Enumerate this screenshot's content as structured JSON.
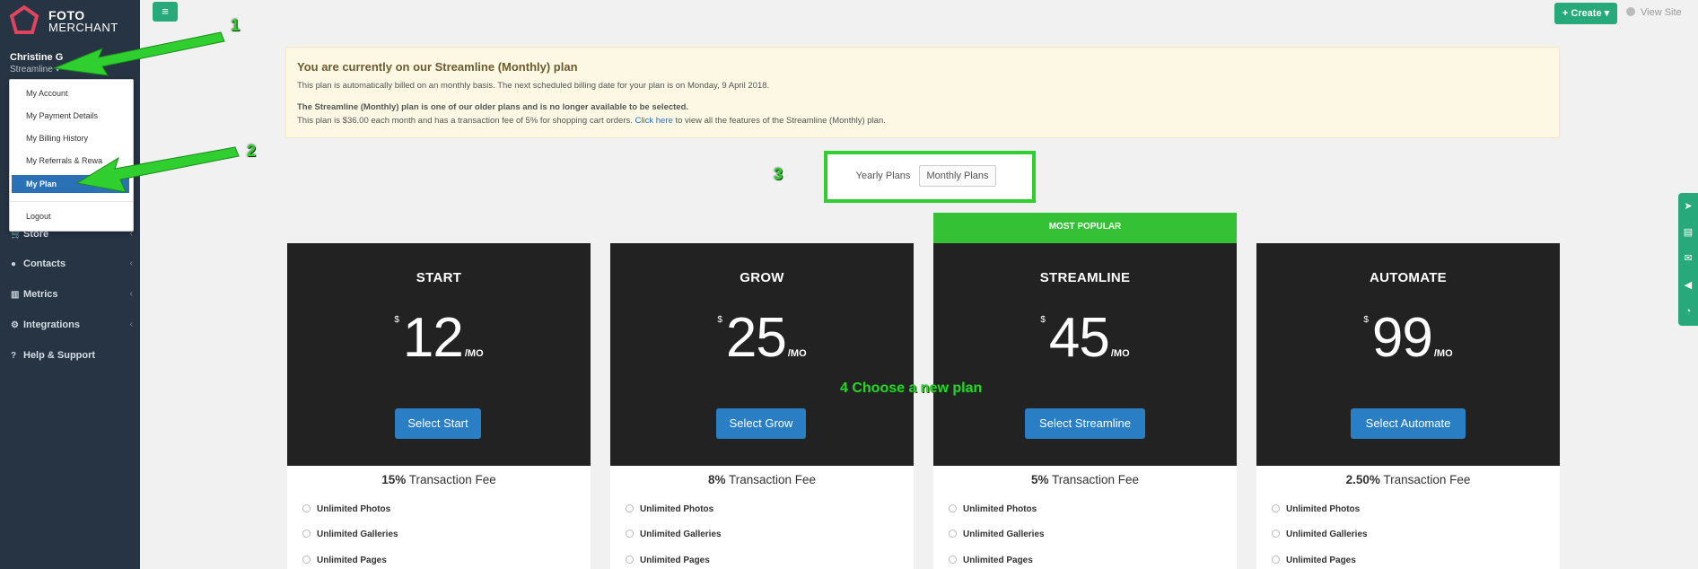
{
  "app": {
    "logo_line1": "FOTO",
    "logo_line2": "MERCHANT",
    "logo_tm": "™"
  },
  "sidebar": {
    "user_name": "Christine G",
    "user_plan": "Streamline ▾",
    "dropdown": [
      {
        "label": "My Account"
      },
      {
        "label": "My Payment Details"
      },
      {
        "label": "My Billing History"
      },
      {
        "label": "My Referrals & Rewa"
      },
      {
        "label": "My Plan",
        "active": true
      },
      {
        "label": "Logout"
      }
    ],
    "nav": [
      {
        "label": "Store",
        "icon": "cart-icon"
      },
      {
        "label": "Contacts",
        "icon": "user-icon"
      },
      {
        "label": "Metrics",
        "icon": "chart-icon"
      },
      {
        "label": "Integrations",
        "icon": "gear-icon"
      },
      {
        "label": "Help & Support",
        "icon": "help-icon"
      }
    ]
  },
  "topbar": {
    "menu_icon": "≡",
    "create_label": "+ Create ▾",
    "view_site_label": "View Site"
  },
  "notice": {
    "title": "You are currently on our Streamline (Monthly) plan",
    "line1": "This plan is automatically billed on an monthly basis. The next scheduled billing date for your plan is on Monday, 9 April 2018.",
    "line2": "The Streamline (Monthly) plan is one of our older plans and is no longer available to be selected.",
    "line3_pre": "This plan is $36.00 each month and has a transaction fee of 5% for shopping cart orders.",
    "line3_link": "Click here",
    "line3_post": "to view all the features of the Streamline (Monthly) plan."
  },
  "toggle": {
    "yearly": "Yearly Plans",
    "monthly": "Monthly Plans",
    "selected": "Monthly Plans"
  },
  "most_popular": "MOST POPULAR",
  "plans": [
    {
      "name": "START",
      "currency": "$",
      "price": "12",
      "per": "/MO",
      "button": "Select Start",
      "fee_pct": "15%",
      "fee_label": "Transaction Fee",
      "features": [
        "Unlimited Photos",
        "Unlimited Galleries",
        "Unlimited Pages"
      ]
    },
    {
      "name": "GROW",
      "currency": "$",
      "price": "25",
      "per": "/MO",
      "button": "Select Grow",
      "fee_pct": "8%",
      "fee_label": "Transaction Fee",
      "features": [
        "Unlimited Photos",
        "Unlimited Galleries",
        "Unlimited Pages"
      ]
    },
    {
      "name": "STREAMLINE",
      "currency": "$",
      "price": "45",
      "per": "/MO",
      "button": "Select Streamline",
      "fee_pct": "5%",
      "fee_label": "Transaction Fee",
      "features": [
        "Unlimited Photos",
        "Unlimited Galleries",
        "Unlimited Pages"
      ]
    },
    {
      "name": "AUTOMATE",
      "currency": "$",
      "price": "99",
      "per": "/MO",
      "button": "Select Automate",
      "fee_pct": "2.50%",
      "fee_label": "Transaction Fee",
      "features": [
        "Unlimited Photos",
        "Unlimited Galleries",
        "Unlimited Pages"
      ]
    }
  ],
  "annotations": {
    "n1": "1",
    "n2": "2",
    "n3": "3",
    "n4": "4 Choose a new plan",
    "color": "#2fcf2f"
  },
  "side_tabs": [
    "rocket-icon",
    "book-icon",
    "mail-icon",
    "megaphone-icon",
    "rss-icon"
  ]
}
